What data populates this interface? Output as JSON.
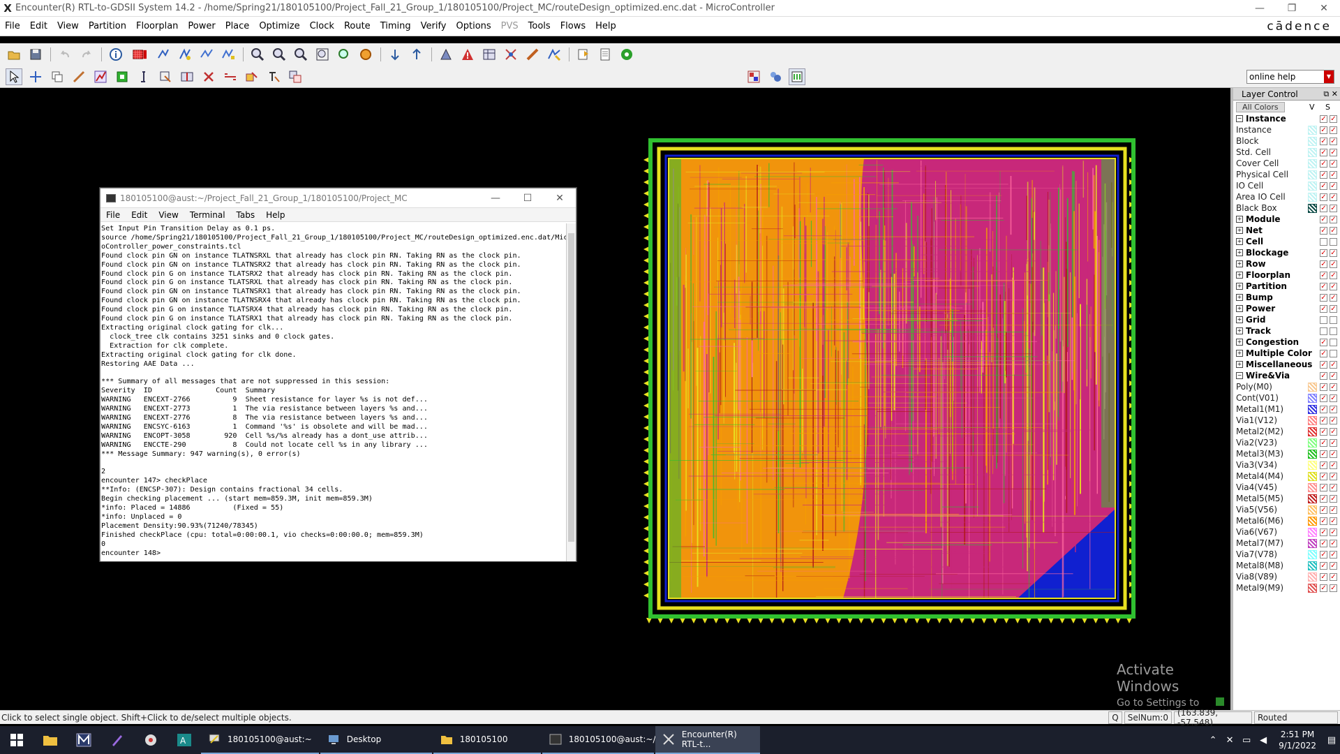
{
  "window": {
    "title": "Encounter(R) RTL-to-GDSII System 14.2 - /home/Spring21/180105100/Project_Fall_21_Group_1/180105100/Project_MC/routeDesign_optimized.enc.dat - MicroController",
    "brand": "cādence"
  },
  "menubar": {
    "items": [
      "File",
      "Edit",
      "View",
      "Partition",
      "Floorplan",
      "Power",
      "Place",
      "Optimize",
      "Clock",
      "Route",
      "Timing",
      "Verify",
      "Options",
      "PVS",
      "Tools",
      "Flows",
      "Help"
    ]
  },
  "toolbar": {
    "online_help": "online help"
  },
  "terminal": {
    "title": "180105100@aust:~/Project_Fall_21_Group_1/180105100/Project_MC",
    "menu": [
      "File",
      "Edit",
      "View",
      "Terminal",
      "Tabs",
      "Help"
    ],
    "output": "Set Input Pin Transition Delay as 0.1 ps.\nsource /home/Spring21/180105100/Project_Fall_21_Group_1/180105100/Project_MC/routeDesign_optimized.enc.dat/Micr\noController_power_constraints.tcl\nFound clock pin GN on instance TLATNSRXL that already has clock pin RN. Taking RN as the clock pin.\nFound clock pin GN on instance TLATNSRX2 that already has clock pin RN. Taking RN as the clock pin.\nFound clock pin G on instance TLATSRX2 that already has clock pin RN. Taking RN as the clock pin.\nFound clock pin G on instance TLATSRXL that already has clock pin RN. Taking RN as the clock pin.\nFound clock pin GN on instance TLATNSRX1 that already has clock pin RN. Taking RN as the clock pin.\nFound clock pin GN on instance TLATNSRX4 that already has clock pin RN. Taking RN as the clock pin.\nFound clock pin G on instance TLATSRX4 that already has clock pin RN. Taking RN as the clock pin.\nFound clock pin G on instance TLATSRX1 that already has clock pin RN. Taking RN as the clock pin.\nExtracting original clock gating for clk...\n  clock_tree clk contains 3251 sinks and 0 clock gates.\n  Extraction for clk complete.\nExtracting original clock gating for clk done.\nRestoring AAE Data ...\n\n*** Summary of all messages that are not suppressed in this session:\nSeverity  ID               Count  Summary\nWARNING   ENCEXT-2766          9  Sheet resistance for layer %s is not def...\nWARNING   ENCEXT-2773          1  The via resistance between layers %s and...\nWARNING   ENCEXT-2776          8  The via resistance between layers %s and...\nWARNING   ENCSYC-6163          1  Command '%s' is obsolete and will be mad...\nWARNING   ENCOPT-3058        920  Cell %s/%s already has a dont_use attrib...\nWARNING   ENCCTE-290           8  Could not locate cell %s in any library ...\n*** Message Summary: 947 warning(s), 0 error(s)\n\n2\nencounter 147> checkPlace\n**Info: (ENCSP-307): Design contains fractional 34 cells.\nBegin checking placement ... (start mem=859.3M, init mem=859.3M)\n*info: Placed = 14886          (Fixed = 55)\n*info: Unplaced = 0\nPlacement Density:90.93%(71240/78345)\nFinished checkPlace (cpu: total=0:00:00.1, vio checks=0:00:00.0; mem=859.3M)\n0\nencounter 148>"
  },
  "layer_control": {
    "title": "Layer Control",
    "all_colors": "All Colors",
    "vs": "V S",
    "rows": [
      {
        "label": "Instance",
        "type": "group",
        "open": true
      },
      {
        "label": "Instance",
        "type": "sub",
        "color": "#bff3f3"
      },
      {
        "label": "Block",
        "type": "sub",
        "color": "#bff3f3"
      },
      {
        "label": "Std. Cell",
        "type": "sub",
        "color": "#bff3f3"
      },
      {
        "label": "Cover Cell",
        "type": "sub",
        "color": "#bff3f3"
      },
      {
        "label": "Physical Cell",
        "type": "sub",
        "color": "#bff3f3"
      },
      {
        "label": "IO Cell",
        "type": "sub",
        "color": "#bff3f3"
      },
      {
        "label": "Area IO Cell",
        "type": "sub",
        "color": "#bff3f3"
      },
      {
        "label": "Black Box",
        "type": "sub",
        "color": "#0b4a45"
      },
      {
        "label": "Module",
        "type": "group"
      },
      {
        "label": "Net",
        "type": "group"
      },
      {
        "label": "Cell",
        "type": "group"
      },
      {
        "label": "Blockage",
        "type": "group"
      },
      {
        "label": "Row",
        "type": "group"
      },
      {
        "label": "Floorplan",
        "type": "group"
      },
      {
        "label": "Partition",
        "type": "group"
      },
      {
        "label": "Bump",
        "type": "group"
      },
      {
        "label": "Power",
        "type": "group"
      },
      {
        "label": "Grid",
        "type": "group"
      },
      {
        "label": "Track",
        "type": "group"
      },
      {
        "label": "Congestion",
        "type": "group"
      },
      {
        "label": "Multiple Color",
        "type": "group"
      },
      {
        "label": "Miscellaneous",
        "type": "group"
      },
      {
        "label": "Wire&Via",
        "type": "group",
        "open": true
      },
      {
        "label": "Poly(M0)",
        "type": "sub",
        "color": "#f8c890"
      },
      {
        "label": "Cont(V01)",
        "type": "sub",
        "color": "#8080ff"
      },
      {
        "label": "Metal1(M1)",
        "type": "sub",
        "color": "#3030e0"
      },
      {
        "label": "Via1(V12)",
        "type": "sub",
        "color": "#ff8080"
      },
      {
        "label": "Metal2(M2)",
        "type": "sub",
        "color": "#e03030"
      },
      {
        "label": "Via2(V23)",
        "type": "sub",
        "color": "#80ff80"
      },
      {
        "label": "Metal3(M3)",
        "type": "sub",
        "color": "#20c020"
      },
      {
        "label": "Via3(V34)",
        "type": "sub",
        "color": "#ffff80"
      },
      {
        "label": "Metal4(M4)",
        "type": "sub",
        "color": "#e0e020"
      },
      {
        "label": "Via4(V45)",
        "type": "sub",
        "color": "#ff9090"
      },
      {
        "label": "Metal5(M5)",
        "type": "sub",
        "color": "#c02020"
      },
      {
        "label": "Via5(V56)",
        "type": "sub",
        "color": "#ffc060"
      },
      {
        "label": "Metal6(M6)",
        "type": "sub",
        "color": "#ff9900"
      },
      {
        "label": "Via6(V67)",
        "type": "sub",
        "color": "#ff80ff"
      },
      {
        "label": "Metal7(M7)",
        "type": "sub",
        "color": "#c040c0"
      },
      {
        "label": "Via7(V78)",
        "type": "sub",
        "color": "#80ffff"
      },
      {
        "label": "Metal8(M8)",
        "type": "sub",
        "color": "#20c0c0"
      },
      {
        "label": "Via8(V89)",
        "type": "sub",
        "color": "#ffb0b0"
      },
      {
        "label": "Metal9(M9)",
        "type": "sub",
        "color": "#e05050"
      }
    ]
  },
  "canvas": {
    "watermark_title": "Activate Windows",
    "watermark_sub": "Go to Settings to activate Windows."
  },
  "statusbar": {
    "message": "Click to select single object. Shift+Click to de/select multiple objects.",
    "q": "Q",
    "selnum": "SelNum:0",
    "coords": "(163.839, -57.548)",
    "state": "Routed"
  },
  "taskbar": {
    "apps": [
      {
        "label": "180105100@aust:~",
        "active": false
      },
      {
        "label": "Desktop",
        "active": false
      },
      {
        "label": "180105100",
        "active": false
      },
      {
        "label": "180105100@aust:~/...",
        "active": false
      },
      {
        "label": "Encounter(R) RTL-t...",
        "active": true
      }
    ],
    "time": "2:51 PM",
    "date": "9/1/2022"
  },
  "colors": {
    "metal_orange": "#f5a000",
    "metal_magenta": "#c8287a",
    "metal_green": "#30c030",
    "metal_yellow": "#e8e020",
    "metal_blue": "#1020d0"
  }
}
